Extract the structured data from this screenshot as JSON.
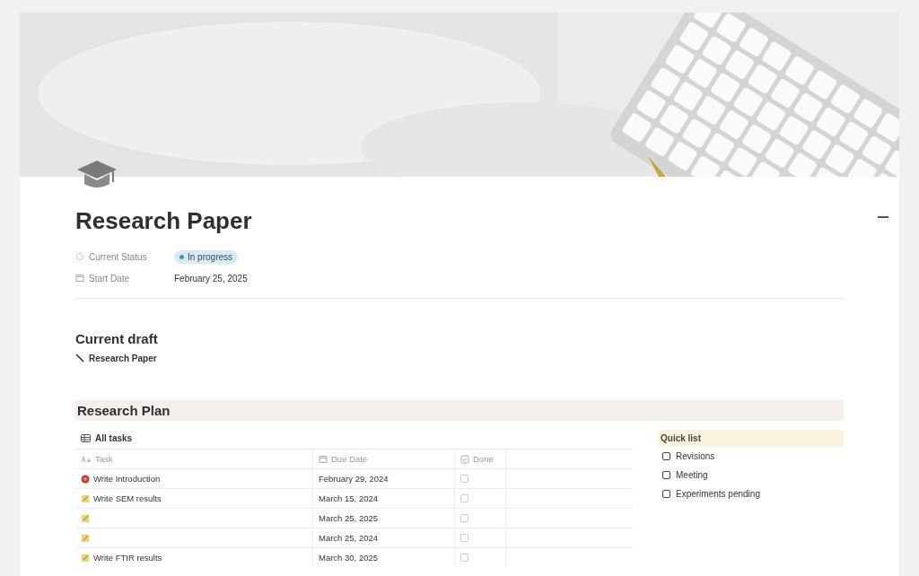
{
  "page": {
    "title": "Research Paper",
    "properties": [
      {
        "kind": "status",
        "label": "Current Status",
        "value": "In progress"
      },
      {
        "kind": "date",
        "label": "Start Date",
        "value": "February 25, 2025"
      }
    ]
  },
  "current_draft": {
    "heading": "Current draft",
    "link": "Research Paper"
  },
  "research_plan": {
    "heading": "Research Plan",
    "view_tab": "All tasks",
    "columns": [
      {
        "kind": "title",
        "label": "Task"
      },
      {
        "kind": "date",
        "label": "Due Date"
      },
      {
        "kind": "checkbox",
        "label": "Done"
      }
    ],
    "rows": [
      {
        "kind": "target",
        "task": "Write Introduction",
        "due": "February 29, 2024",
        "done": false
      },
      {
        "kind": "note",
        "task": "Write SEM results",
        "due": "March 15, 2024",
        "done": false
      },
      {
        "kind": "note",
        "due": "March 25, 2025",
        "done": false
      },
      {
        "kind": "note",
        "due": "March 25, 2024",
        "done": false
      },
      {
        "kind": "note",
        "task": "Write FTIR results",
        "due": "March 30, 2025",
        "done": false
      }
    ]
  },
  "quick_list": {
    "heading": "Quick list",
    "items": [
      {
        "label": "Revisions",
        "checked": false
      },
      {
        "label": "Meeting",
        "checked": false
      },
      {
        "label": "Experiments pending",
        "checked": false
      }
    ]
  }
}
